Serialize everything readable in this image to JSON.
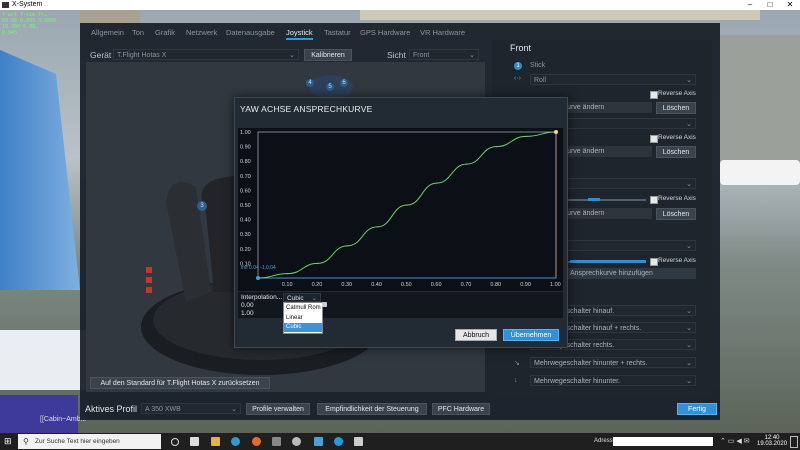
{
  "window": {
    "title": "X-System"
  },
  "debug": [
    "f-act  f-sim  fr…",
    "00.60  0.005  0.0000",
    "10.700  0.00…",
    "0.045"
  ],
  "background": {
    "cabin_label": "[[Cabin~Ambie"
  },
  "tabs": [
    "Allgemein",
    "Ton",
    "Grafik",
    "Netzwerk",
    "Datenausgabe",
    "Joystick",
    "Tastatur",
    "GPS Hardware",
    "VR Hardware"
  ],
  "active_tab": "Joystick",
  "device": {
    "label": "Gerät",
    "value": "T.Flight Hotas X",
    "calibrate": "Kalibrieren"
  },
  "view": {
    "label": "Sicht",
    "value": "Front"
  },
  "joystick_marks": {
    "axis3": "3",
    "b4": "4",
    "b5": "5",
    "b6": "6"
  },
  "reset_button": "Auf den Standard für T.Flight Hotas X zurücksetzen",
  "right_panel": {
    "title": "Front",
    "stick_num": "1",
    "stick_label": "Stick",
    "roll": "Roll",
    "reverse": "Reverse Axis",
    "curve_change": "Ansprechkurve ändern",
    "delete": "Löschen",
    "curve_add": "Ansprechkurve hinzufügen",
    "buttons": [
      "Mehrwegeschalter hinauf.",
      "Mehrwegeschalter hinauf + rechts.",
      "Mehrwegeschalter rechts.",
      "Mehrwegeschalter hinunter + rechts.",
      "Mehrwegeschalter hinunter."
    ]
  },
  "bottom": {
    "profile_label": "Aktives Profil",
    "profile_value": "A 350 XWB",
    "manage": "Profile verwalten",
    "sensitivity": "Empfindlichkeit der Steuerung",
    "pfc": "PFC Hardware",
    "done": "Fertig"
  },
  "dialog": {
    "title": "YAW ACHSE ANSPRECHKURVE",
    "point_readout": "in/f  0.04  -1.0.04",
    "interp_label": "Interpolation...",
    "interp_value": "Cubic",
    "val1": "0.00",
    "val2": "1.00",
    "options": [
      "Catmull Rom",
      "Linear",
      "Cubic"
    ],
    "selected_option": "Cubic",
    "cancel": "Abbruch",
    "accept": "Übernehmen"
  },
  "chart_data": {
    "type": "line",
    "x_ticks": [
      "0.10",
      "0.20",
      "0.30",
      "0.40",
      "0.50",
      "0.60",
      "0.70",
      "0.80",
      "0.90",
      "1.00"
    ],
    "y_ticks": [
      "0.10",
      "0.20",
      "0.30",
      "0.40",
      "0.50",
      "0.60",
      "0.70",
      "0.80",
      "0.90",
      "1.00"
    ],
    "xlim": [
      0,
      1
    ],
    "ylim": [
      0,
      1
    ],
    "series": [
      {
        "x": [
          0,
          0.1,
          0.2,
          0.3,
          0.4,
          0.5,
          0.6,
          0.7,
          0.8,
          0.9,
          1.0
        ],
        "y": [
          0,
          0.03,
          0.1,
          0.22,
          0.35,
          0.5,
          0.65,
          0.78,
          0.9,
          0.97,
          1.0
        ],
        "color": "#6fd06a"
      }
    ]
  },
  "taskbar": {
    "search_placeholder": "Zur Suche Text hier eingeben",
    "address_label": "Adresse",
    "time": "12:40",
    "date": "19.03.2020"
  },
  "colors": {
    "accent": "#2c9be0",
    "curve": "#6fd06a",
    "panel": "#1e252d"
  }
}
